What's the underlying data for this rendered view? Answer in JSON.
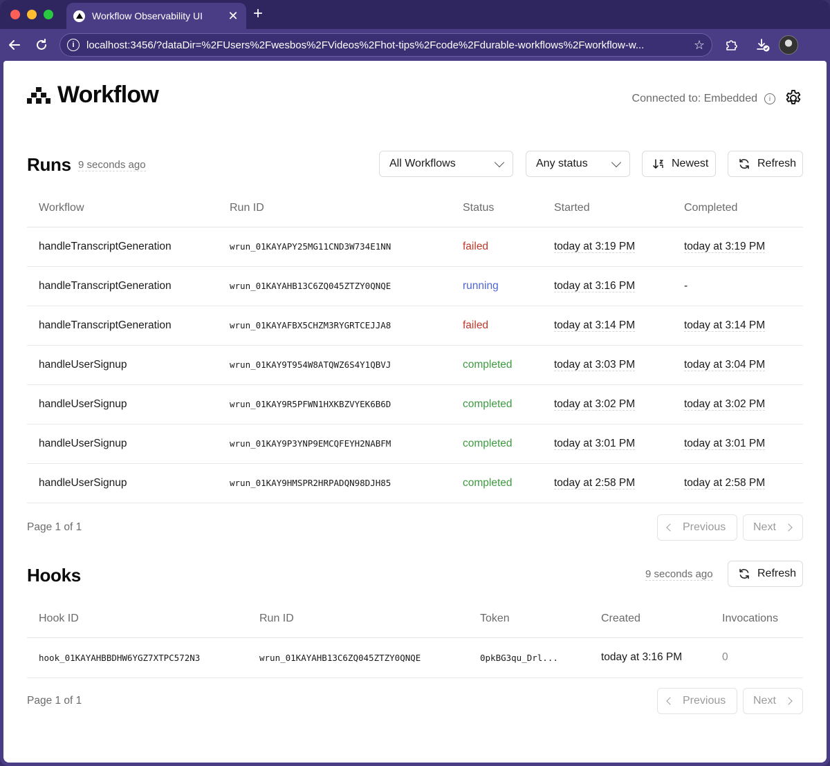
{
  "browser": {
    "tab_title": "Workflow Observability UI",
    "tab_close": "✕",
    "new_tab": "+",
    "url": "localhost:3456/?dataDir=%2FUsers%2Fwesbos%2FVideos%2Fhot-tips%2Fcode%2Fdurable-workflows%2Fworkflow-w..."
  },
  "header": {
    "title": "Workflow",
    "connection": "Connected to: Embedded"
  },
  "runs": {
    "title": "Runs",
    "updated": "9 seconds ago",
    "filter_workflow": "All Workflows",
    "filter_status": "Any status",
    "sort_label": "Newest",
    "refresh_label": "Refresh",
    "columns": [
      "Workflow",
      "Run ID",
      "Status",
      "Started",
      "Completed"
    ],
    "rows": [
      {
        "workflow": "handleTranscriptGeneration",
        "run_id": "wrun_01KAYAPY25MG11CND3W734E1NN",
        "status": "failed",
        "started": "today at 3:19 PM",
        "completed": "today at 3:19 PM"
      },
      {
        "workflow": "handleTranscriptGeneration",
        "run_id": "wrun_01KAYAHB13C6ZQ045ZTZY0QNQE",
        "status": "running",
        "started": "today at 3:16 PM",
        "completed": "-"
      },
      {
        "workflow": "handleTranscriptGeneration",
        "run_id": "wrun_01KAYAFBX5CHZM3RYGRTCEJJA8",
        "status": "failed",
        "started": "today at 3:14 PM",
        "completed": "today at 3:14 PM"
      },
      {
        "workflow": "handleUserSignup",
        "run_id": "wrun_01KAY9T954W8ATQWZ6S4Y1QBVJ",
        "status": "completed",
        "started": "today at 3:03 PM",
        "completed": "today at 3:04 PM"
      },
      {
        "workflow": "handleUserSignup",
        "run_id": "wrun_01KAY9R5PFWN1HXKBZVYEK6B6D",
        "status": "completed",
        "started": "today at 3:02 PM",
        "completed": "today at 3:02 PM"
      },
      {
        "workflow": "handleUserSignup",
        "run_id": "wrun_01KAY9P3YNP9EMCQFEYH2NABFM",
        "status": "completed",
        "started": "today at 3:01 PM",
        "completed": "today at 3:01 PM"
      },
      {
        "workflow": "handleUserSignup",
        "run_id": "wrun_01KAY9HMSPR2HRPADQN98DJH85",
        "status": "completed",
        "started": "today at 2:58 PM",
        "completed": "today at 2:58 PM"
      }
    ],
    "page_info": "Page 1 of 1",
    "prev_label": "Previous",
    "next_label": "Next"
  },
  "hooks": {
    "title": "Hooks",
    "updated": "9 seconds ago",
    "refresh_label": "Refresh",
    "columns": [
      "Hook ID",
      "Run ID",
      "Token",
      "Created",
      "Invocations"
    ],
    "rows": [
      {
        "hook_id": "hook_01KAYAHBBDHW6YGZ7XTPC572N3",
        "run_id": "wrun_01KAYAHB13C6ZQ045ZTZY0QNQE",
        "token": "0pkBG3qu_Drl...",
        "created": "today at 3:16 PM",
        "invocations": "0"
      }
    ],
    "page_info": "Page 1 of 1",
    "prev_label": "Previous",
    "next_label": "Next"
  },
  "colors": {
    "failed": "#c0392b",
    "running": "#4e64d6",
    "completed": "#3d9a3f",
    "browser_chrome": "#4a3d86"
  },
  "icons": [
    "search-icon",
    "back-arrow-icon",
    "reload-icon",
    "info-icon",
    "star-icon",
    "extensions-icon",
    "download-icon",
    "gear-icon",
    "chevron-down-icon",
    "sort-icon",
    "refresh-icon",
    "chevron-left-icon",
    "chevron-right-icon",
    "workflow-logo-icon"
  ]
}
